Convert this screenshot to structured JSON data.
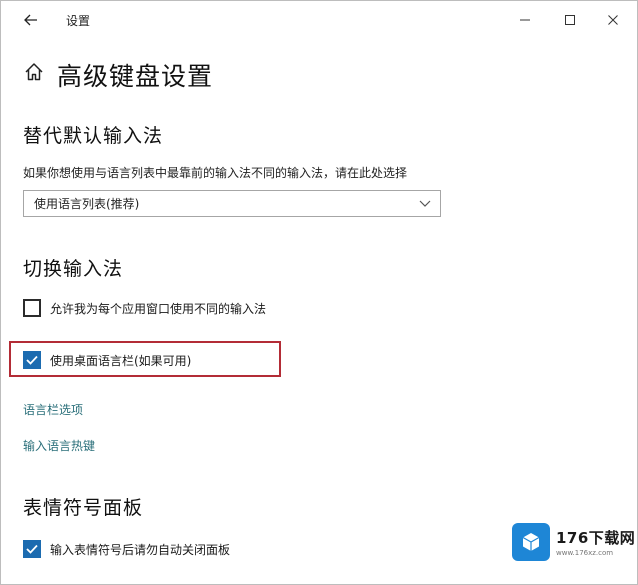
{
  "window": {
    "title": "设置",
    "back_icon": "arrow-left-icon",
    "controls": [
      "minimize-icon",
      "maximize-icon",
      "close-icon"
    ]
  },
  "header": {
    "icon": "home-icon",
    "title": "高级键盘设置"
  },
  "override_input": {
    "title": "替代默认输入法",
    "description": "如果你想使用与语言列表中最靠前的输入法不同的输入法，请在此处选择",
    "dropdown_value": "使用语言列表(推荐)"
  },
  "switch_input": {
    "title": "切换输入法",
    "checkbox_per_app": {
      "label": "允许我为每个应用窗口使用不同的输入法",
      "checked": false
    },
    "checkbox_langbar": {
      "label": "使用桌面语言栏(如果可用)",
      "checked": true
    },
    "link_langbar_options": "语言栏选项",
    "link_hotkeys": "输入语言热键"
  },
  "emoji_panel": {
    "title": "表情符号面板",
    "checkbox_autoclose": {
      "label": "输入表情符号后请勿自动关闭面板",
      "checked": true
    }
  },
  "watermark": {
    "name": "176下载网",
    "url": "www.176xz.com"
  },
  "colors": {
    "accent": "#1c6bb0",
    "link": "#2a6f7a",
    "highlight": "#b32c36"
  }
}
